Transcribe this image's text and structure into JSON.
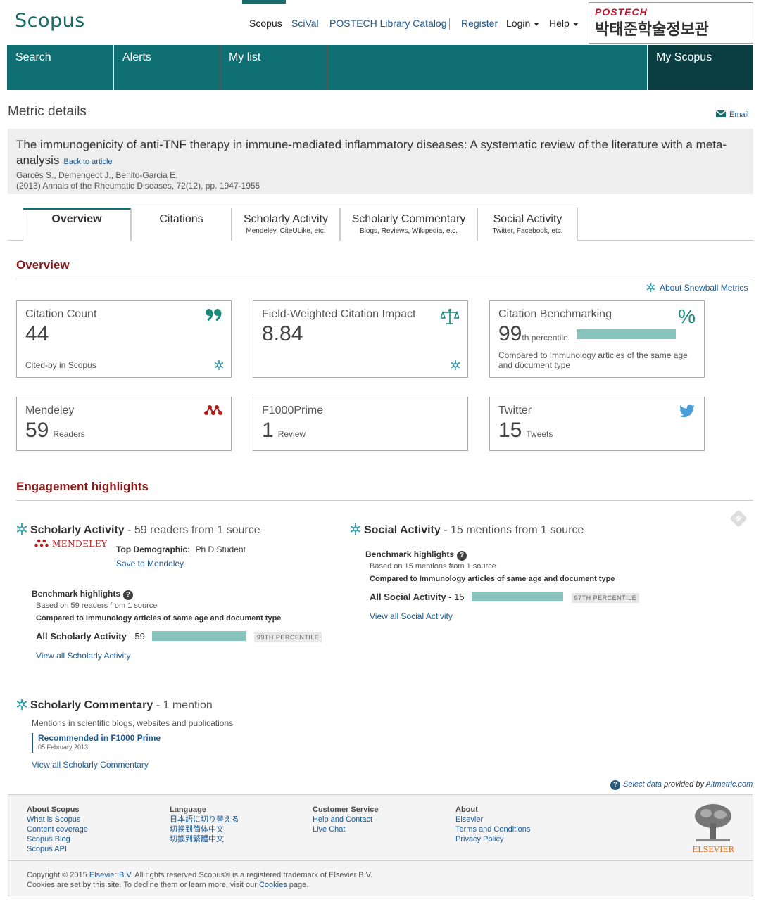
{
  "header": {
    "logo": "Scopus",
    "links": [
      "Scopus",
      "SciVal",
      "POSTECH Library Catalog",
      "Register",
      "Login",
      "Help"
    ],
    "postech_en": "POSTECH",
    "postech_kr": "박태준학술정보관"
  },
  "nav": {
    "items": [
      "Search",
      "Alerts",
      "My list",
      "My Scopus"
    ]
  },
  "page": {
    "title": "Metric details",
    "email": "Email"
  },
  "article": {
    "title": "The immunogenicity of anti-TNF therapy in immune-mediated inflammatory diseases: A systematic review of the literature with a meta-analysis",
    "back": "Back to article",
    "authors": "Garcês S., Demengeot J., Benito-Garcia E.",
    "source": "(2013) Annals of the Rheumatic Diseases, 72(12), pp. 1947-1955"
  },
  "tabs": [
    {
      "label": "Overview",
      "sub": ""
    },
    {
      "label": "Citations",
      "sub": ""
    },
    {
      "label": "Scholarly Activity",
      "sub": "Mendeley, CiteULike, etc."
    },
    {
      "label": "Scholarly Commentary",
      "sub": "Blogs, Reviews, Wikipedia, etc."
    },
    {
      "label": "Social Activity",
      "sub": "Twitter, Facebook, etc."
    }
  ],
  "overview": {
    "heading": "Overview",
    "about_snowball": "About Snowball Metrics",
    "citation_count": {
      "title": "Citation Count",
      "value": "44",
      "sub": "Cited-by in Scopus"
    },
    "fwci": {
      "title": "Field-Weighted Citation Impact",
      "value": "8.84"
    },
    "benchmark": {
      "title": "Citation Benchmarking",
      "value": "99",
      "suffix": "th percentile",
      "percentile": 99,
      "sub": "Compared to Immunology articles of the same age and document type"
    },
    "mendeley": {
      "title": "Mendeley",
      "value": "59",
      "unit": "Readers"
    },
    "f1000": {
      "title": "F1000Prime",
      "value": "1",
      "unit": "Review"
    },
    "twitter": {
      "title": "Twitter",
      "value": "15",
      "unit": "Tweets"
    }
  },
  "engagement": {
    "heading": "Engagement highlights",
    "scholarly": {
      "title": "Scholarly Activity",
      "summary": " - 59 readers from 1 source",
      "mendeley_logo": "MENDELEY",
      "demo_label": "Top Demographic:",
      "demo_value": "Ph D Student",
      "save": "Save to Mendeley",
      "bench_title": "Benchmark highlights",
      "based": "Based on 59 readers from 1 source",
      "compared": "Compared to Immunology articles of same age and document type",
      "all_label": "All Scholarly Activity",
      "all_value": " - 59",
      "percentile_label": "99TH PERCENTILE",
      "percentile": 99,
      "view_all": "View all Scholarly Activity"
    },
    "social": {
      "title": "Social Activity",
      "summary": " - 15 mentions from 1 source",
      "bench_title": "Benchmark highlights",
      "based": "Based on 15 mentions from 1 source",
      "compared": "Compared to Immunology articles of same age and document type",
      "all_label": "All Social Activity",
      "all_value": " - 15",
      "percentile_label": "97TH PERCENTILE",
      "percentile": 97,
      "view_all": "View all Social Activity"
    },
    "commentary": {
      "title": "Scholarly Commentary",
      "summary": " - 1 mention",
      "desc": "Mentions in scientific blogs, websites and publications",
      "item_title": "Recommended in F1000 Prime",
      "item_date": "05 February 2013",
      "view_all": "View all Scholarly Commentary"
    },
    "altmetric": {
      "select": "Select data",
      "provided": " provided by ",
      "source": "Altmetric.com"
    }
  },
  "footer": {
    "cols": [
      {
        "heading": "About Scopus",
        "links": [
          "What is Scopus",
          "Content coverage",
          "Scopus Blog",
          "Scopus API"
        ]
      },
      {
        "heading": "Language",
        "links": [
          "日本語に切り替える",
          "切换到简体中文",
          "切換到繁體中文"
        ]
      },
      {
        "heading": "Customer Service",
        "links": [
          "Help and Contact",
          "Live Chat"
        ]
      },
      {
        "heading": "About",
        "links": [
          "Elsevier",
          "Terms and Conditions",
          "Privacy Policy"
        ]
      }
    ],
    "elsevier": "ELSEVIER",
    "copy1a": "Copyright © 2015 ",
    "copy1b": "Elsevier B.V.",
    "copy1c": " All rights reserved.Scopus® is a registered trademark of Elsevier B.V.",
    "copy2a": "Cookies are set by this site. To decline them or learn more, visit our ",
    "copy2b": "Cookies",
    "copy2c": " page."
  },
  "colors": {
    "teal": "#0f6f73",
    "dark_teal": "#0a3e40",
    "section_red": "#8b1a1a",
    "bar": "#88c4bd",
    "link": "#1a5a96"
  }
}
